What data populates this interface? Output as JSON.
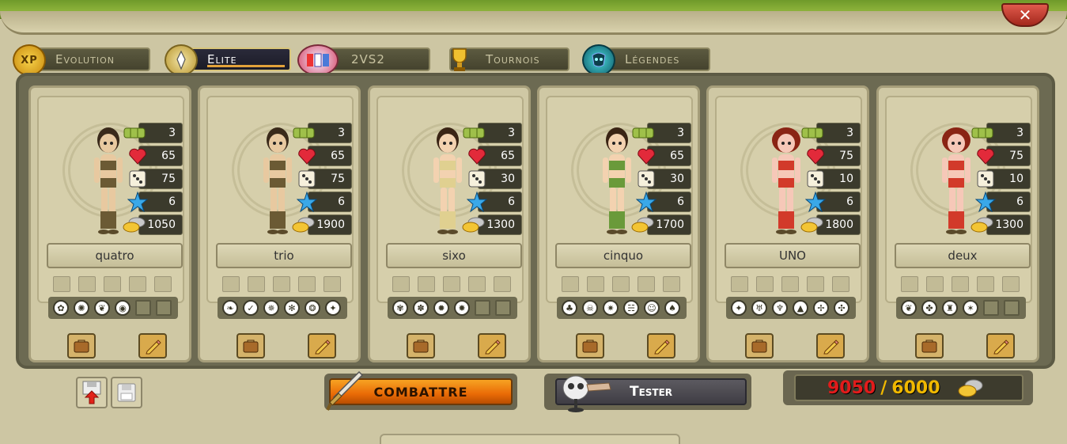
{
  "window": {
    "close_label": "✕"
  },
  "tabs": [
    {
      "label": "Evolution",
      "icon": "xp-icon",
      "active": false
    },
    {
      "label": "Elite",
      "icon": "elite-wing-icon",
      "active": true
    },
    {
      "label": "2VS2",
      "icon": "2vs2-icon",
      "active": false
    },
    {
      "label": "Tournois",
      "icon": "tournament-trophy-icon",
      "active": false
    },
    {
      "label": "Légendes",
      "icon": "legends-mask-icon",
      "active": false
    }
  ],
  "characters": [
    {
      "name": "quatro",
      "level": "3",
      "life": "65",
      "initiative": "75",
      "points": "6",
      "cost": "1050",
      "spells": [
        "✿",
        "✺",
        "❦",
        "◉"
      ]
    },
    {
      "name": "trio",
      "level": "3",
      "life": "65",
      "initiative": "75",
      "points": "6",
      "cost": "1900",
      "spells": [
        "❧",
        "✓",
        "✵",
        "✻",
        "❂",
        "✦"
      ]
    },
    {
      "name": "sixo",
      "level": "3",
      "life": "65",
      "initiative": "30",
      "points": "6",
      "cost": "1300",
      "spells": [
        "✾",
        "✽",
        "✹",
        "✸"
      ]
    },
    {
      "name": "cinquo",
      "level": "3",
      "life": "65",
      "initiative": "30",
      "points": "6",
      "cost": "1700",
      "spells": [
        "♣",
        "☠",
        "✷",
        "☵",
        "☺",
        "♠"
      ]
    },
    {
      "name": "UNO",
      "level": "3",
      "life": "75",
      "initiative": "10",
      "points": "6",
      "cost": "1800",
      "spells": [
        "✦",
        "♅",
        "♆",
        "▲",
        "✢",
        "✣"
      ]
    },
    {
      "name": "deux",
      "level": "3",
      "life": "75",
      "initiative": "10",
      "points": "6",
      "cost": "1300",
      "spells": [
        "❦",
        "✤",
        "♜",
        "✶"
      ]
    }
  ],
  "actions": {
    "fight_label": "Combattre",
    "test_label": "Tester"
  },
  "budget": {
    "spent": "9050",
    "separator": "/",
    "max": "6000"
  },
  "colors": {
    "accent": "#e96a06",
    "over_budget": "#e21b1b",
    "max_budget": "#f0b800"
  }
}
